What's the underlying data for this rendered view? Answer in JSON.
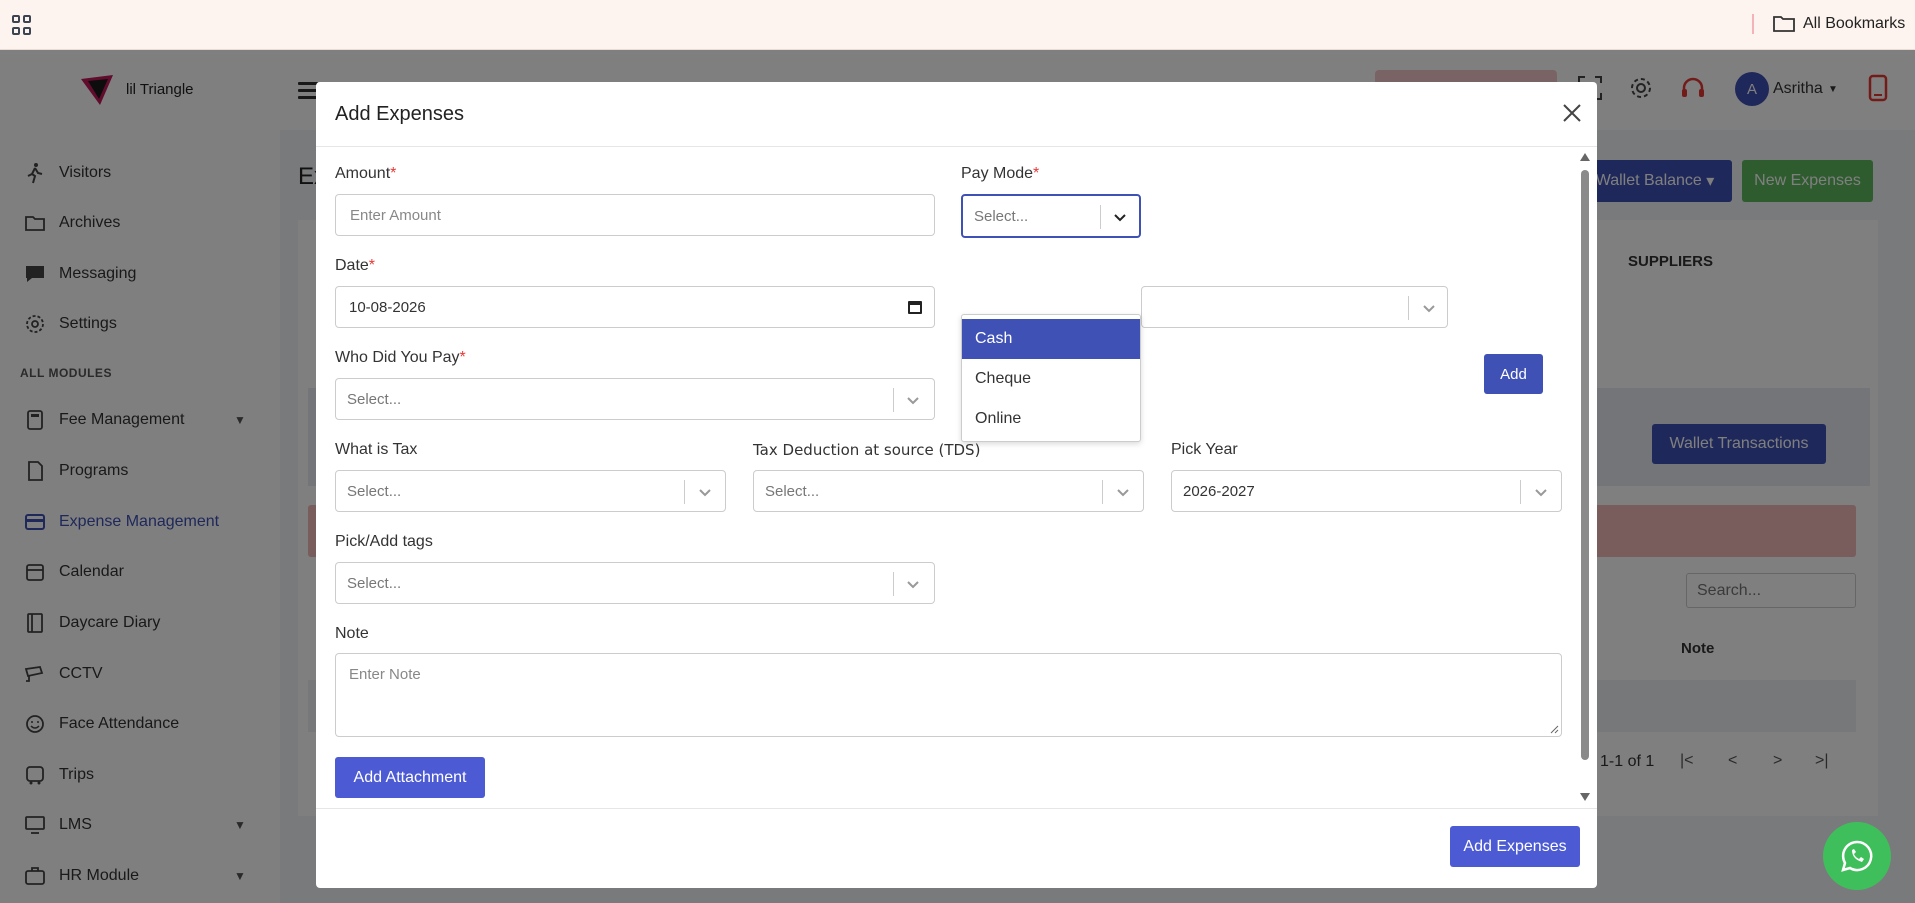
{
  "browser": {
    "bookmarks_label": "All Bookmarks"
  },
  "app": {
    "logo_text": "lil Triangle",
    "user_initial": "A",
    "user_name": "Asritha",
    "page_title": "Ex"
  },
  "sidebar": {
    "items_top": [
      {
        "label": "Visitors",
        "icon": "visitor-walk-icon"
      },
      {
        "label": "Archives",
        "icon": "folder-icon"
      },
      {
        "label": "Messaging",
        "icon": "chat-icon"
      },
      {
        "label": "Settings",
        "icon": "gear-icon"
      }
    ],
    "section_label": "ALL MODULES",
    "items_modules": [
      {
        "label": "Fee Management",
        "icon": "calculator-icon",
        "expandable": true
      },
      {
        "label": "Programs",
        "icon": "document-icon"
      },
      {
        "label": "Expense Management",
        "icon": "card-icon",
        "active": true
      },
      {
        "label": "Calendar",
        "icon": "calendar-icon"
      },
      {
        "label": "Daycare Diary",
        "icon": "book-icon"
      },
      {
        "label": "CCTV",
        "icon": "camera-icon"
      },
      {
        "label": "Face Attendance",
        "icon": "face-icon"
      },
      {
        "label": "Trips",
        "icon": "bus-icon"
      },
      {
        "label": "LMS",
        "icon": "monitor-icon",
        "expandable": true
      },
      {
        "label": "HR Module",
        "icon": "briefcase-icon",
        "expandable": true
      }
    ]
  },
  "background_page": {
    "wallet_balance_label": "Wallet Balance",
    "new_expenses_label": "New Expenses",
    "suppliers_tab": "SUPPLIERS",
    "wallet_transactions_label": "Wallet Transactions",
    "search_placeholder": "Search...",
    "note_column": "Note",
    "pagination_text": "1-1 of 1"
  },
  "modal": {
    "title": "Add Expenses",
    "fields": {
      "amount": {
        "label": "Amount",
        "placeholder": "Enter Amount",
        "required": "*"
      },
      "pay_mode": {
        "label": "Pay Mode",
        "placeholder": "Select...",
        "required": "*"
      },
      "date": {
        "label": "Date",
        "value": "10-08-2026",
        "required": "*"
      },
      "who_paid": {
        "label": "Who Did You Pay",
        "placeholder": "Select...",
        "required": "*"
      },
      "tax": {
        "label": "What is Tax",
        "placeholder": "Select..."
      },
      "tds": {
        "label": "Tax Deduction at source (TDS)",
        "placeholder": "Select..."
      },
      "pick_year": {
        "label": "Pick Year",
        "value": "2026-2027"
      },
      "tags": {
        "label": "Pick/Add tags",
        "placeholder": "Select..."
      },
      "note": {
        "label": "Note",
        "placeholder": "Enter Note"
      }
    },
    "pay_mode_options": [
      "Cash",
      "Cheque",
      "Online"
    ],
    "pay_mode_highlighted": "Cash",
    "add_label": "Add",
    "add_attachment_label": "Add Attachment",
    "submit_label": "Add Expenses"
  },
  "colors": {
    "primary": "#3f51b5",
    "success": "#5cb85c",
    "required": "#e53935"
  }
}
